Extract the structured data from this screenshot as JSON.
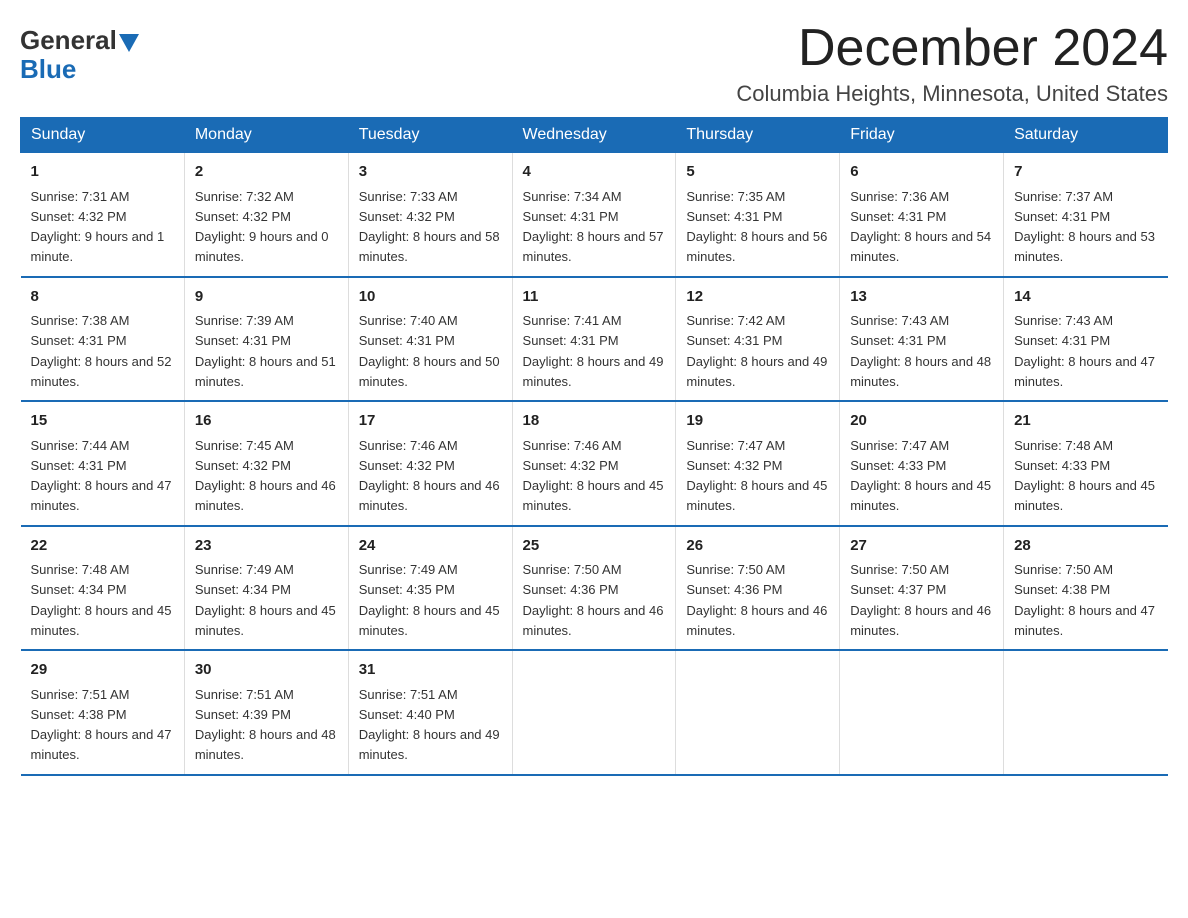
{
  "logo": {
    "general": "General",
    "blue": "Blue"
  },
  "title": {
    "month_year": "December 2024",
    "location": "Columbia Heights, Minnesota, United States"
  },
  "headers": [
    "Sunday",
    "Monday",
    "Tuesday",
    "Wednesday",
    "Thursday",
    "Friday",
    "Saturday"
  ],
  "weeks": [
    [
      {
        "day": "1",
        "sunrise": "7:31 AM",
        "sunset": "4:32 PM",
        "daylight": "9 hours and 1 minute."
      },
      {
        "day": "2",
        "sunrise": "7:32 AM",
        "sunset": "4:32 PM",
        "daylight": "9 hours and 0 minutes."
      },
      {
        "day": "3",
        "sunrise": "7:33 AM",
        "sunset": "4:32 PM",
        "daylight": "8 hours and 58 minutes."
      },
      {
        "day": "4",
        "sunrise": "7:34 AM",
        "sunset": "4:31 PM",
        "daylight": "8 hours and 57 minutes."
      },
      {
        "day": "5",
        "sunrise": "7:35 AM",
        "sunset": "4:31 PM",
        "daylight": "8 hours and 56 minutes."
      },
      {
        "day": "6",
        "sunrise": "7:36 AM",
        "sunset": "4:31 PM",
        "daylight": "8 hours and 54 minutes."
      },
      {
        "day": "7",
        "sunrise": "7:37 AM",
        "sunset": "4:31 PM",
        "daylight": "8 hours and 53 minutes."
      }
    ],
    [
      {
        "day": "8",
        "sunrise": "7:38 AM",
        "sunset": "4:31 PM",
        "daylight": "8 hours and 52 minutes."
      },
      {
        "day": "9",
        "sunrise": "7:39 AM",
        "sunset": "4:31 PM",
        "daylight": "8 hours and 51 minutes."
      },
      {
        "day": "10",
        "sunrise": "7:40 AM",
        "sunset": "4:31 PM",
        "daylight": "8 hours and 50 minutes."
      },
      {
        "day": "11",
        "sunrise": "7:41 AM",
        "sunset": "4:31 PM",
        "daylight": "8 hours and 49 minutes."
      },
      {
        "day": "12",
        "sunrise": "7:42 AM",
        "sunset": "4:31 PM",
        "daylight": "8 hours and 49 minutes."
      },
      {
        "day": "13",
        "sunrise": "7:43 AM",
        "sunset": "4:31 PM",
        "daylight": "8 hours and 48 minutes."
      },
      {
        "day": "14",
        "sunrise": "7:43 AM",
        "sunset": "4:31 PM",
        "daylight": "8 hours and 47 minutes."
      }
    ],
    [
      {
        "day": "15",
        "sunrise": "7:44 AM",
        "sunset": "4:31 PM",
        "daylight": "8 hours and 47 minutes."
      },
      {
        "day": "16",
        "sunrise": "7:45 AM",
        "sunset": "4:32 PM",
        "daylight": "8 hours and 46 minutes."
      },
      {
        "day": "17",
        "sunrise": "7:46 AM",
        "sunset": "4:32 PM",
        "daylight": "8 hours and 46 minutes."
      },
      {
        "day": "18",
        "sunrise": "7:46 AM",
        "sunset": "4:32 PM",
        "daylight": "8 hours and 45 minutes."
      },
      {
        "day": "19",
        "sunrise": "7:47 AM",
        "sunset": "4:32 PM",
        "daylight": "8 hours and 45 minutes."
      },
      {
        "day": "20",
        "sunrise": "7:47 AM",
        "sunset": "4:33 PM",
        "daylight": "8 hours and 45 minutes."
      },
      {
        "day": "21",
        "sunrise": "7:48 AM",
        "sunset": "4:33 PM",
        "daylight": "8 hours and 45 minutes."
      }
    ],
    [
      {
        "day": "22",
        "sunrise": "7:48 AM",
        "sunset": "4:34 PM",
        "daylight": "8 hours and 45 minutes."
      },
      {
        "day": "23",
        "sunrise": "7:49 AM",
        "sunset": "4:34 PM",
        "daylight": "8 hours and 45 minutes."
      },
      {
        "day": "24",
        "sunrise": "7:49 AM",
        "sunset": "4:35 PM",
        "daylight": "8 hours and 45 minutes."
      },
      {
        "day": "25",
        "sunrise": "7:50 AM",
        "sunset": "4:36 PM",
        "daylight": "8 hours and 46 minutes."
      },
      {
        "day": "26",
        "sunrise": "7:50 AM",
        "sunset": "4:36 PM",
        "daylight": "8 hours and 46 minutes."
      },
      {
        "day": "27",
        "sunrise": "7:50 AM",
        "sunset": "4:37 PM",
        "daylight": "8 hours and 46 minutes."
      },
      {
        "day": "28",
        "sunrise": "7:50 AM",
        "sunset": "4:38 PM",
        "daylight": "8 hours and 47 minutes."
      }
    ],
    [
      {
        "day": "29",
        "sunrise": "7:51 AM",
        "sunset": "4:38 PM",
        "daylight": "8 hours and 47 minutes."
      },
      {
        "day": "30",
        "sunrise": "7:51 AM",
        "sunset": "4:39 PM",
        "daylight": "8 hours and 48 minutes."
      },
      {
        "day": "31",
        "sunrise": "7:51 AM",
        "sunset": "4:40 PM",
        "daylight": "8 hours and 49 minutes."
      },
      null,
      null,
      null,
      null
    ]
  ]
}
